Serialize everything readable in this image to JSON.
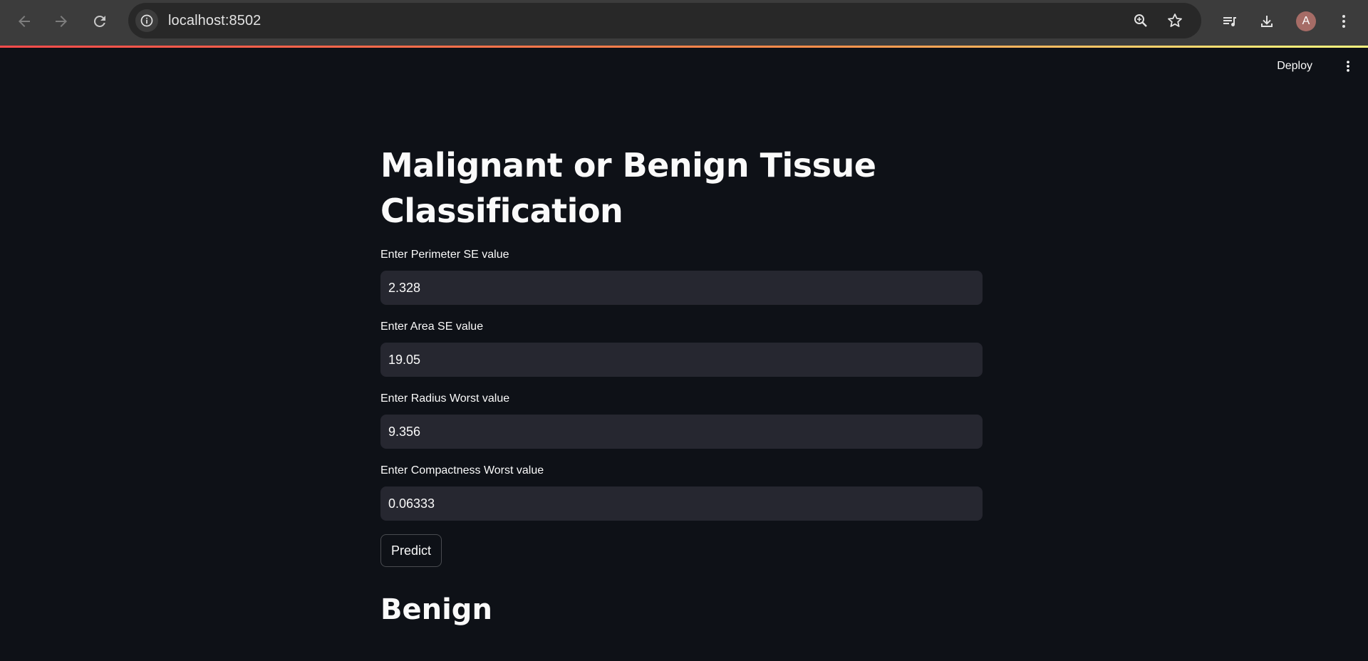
{
  "browser": {
    "url": "localhost:8502",
    "profile_initial": "A",
    "icons": {
      "back": "arrow-left-icon",
      "forward": "arrow-right-icon",
      "reload": "reload-icon",
      "site_info": "info-icon",
      "zoom": "zoom-icon",
      "bookmark": "star-icon",
      "media": "media-queue-icon",
      "downloads": "download-icon",
      "menu": "kebab-menu-icon"
    }
  },
  "header": {
    "deploy_label": "Deploy"
  },
  "page": {
    "title": "Malignant or Benign Tissue Classification",
    "fields": [
      {
        "label": "Enter Perimeter SE value",
        "value": "2.328"
      },
      {
        "label": "Enter Area SE value",
        "value": "19.05"
      },
      {
        "label": "Enter Radius Worst value",
        "value": "9.356"
      },
      {
        "label": "Enter Compactness Worst value",
        "value": "0.06333"
      }
    ],
    "predict_label": "Predict",
    "result": "Benign"
  },
  "colors": {
    "background": "#0e1117",
    "input_bg": "#262730",
    "text": "#fafafa",
    "browser_bar": "#3c3c3c",
    "omnibox": "#282828",
    "accent_line_start": "#ff4b4b",
    "accent_line_end": "#fffd80"
  }
}
